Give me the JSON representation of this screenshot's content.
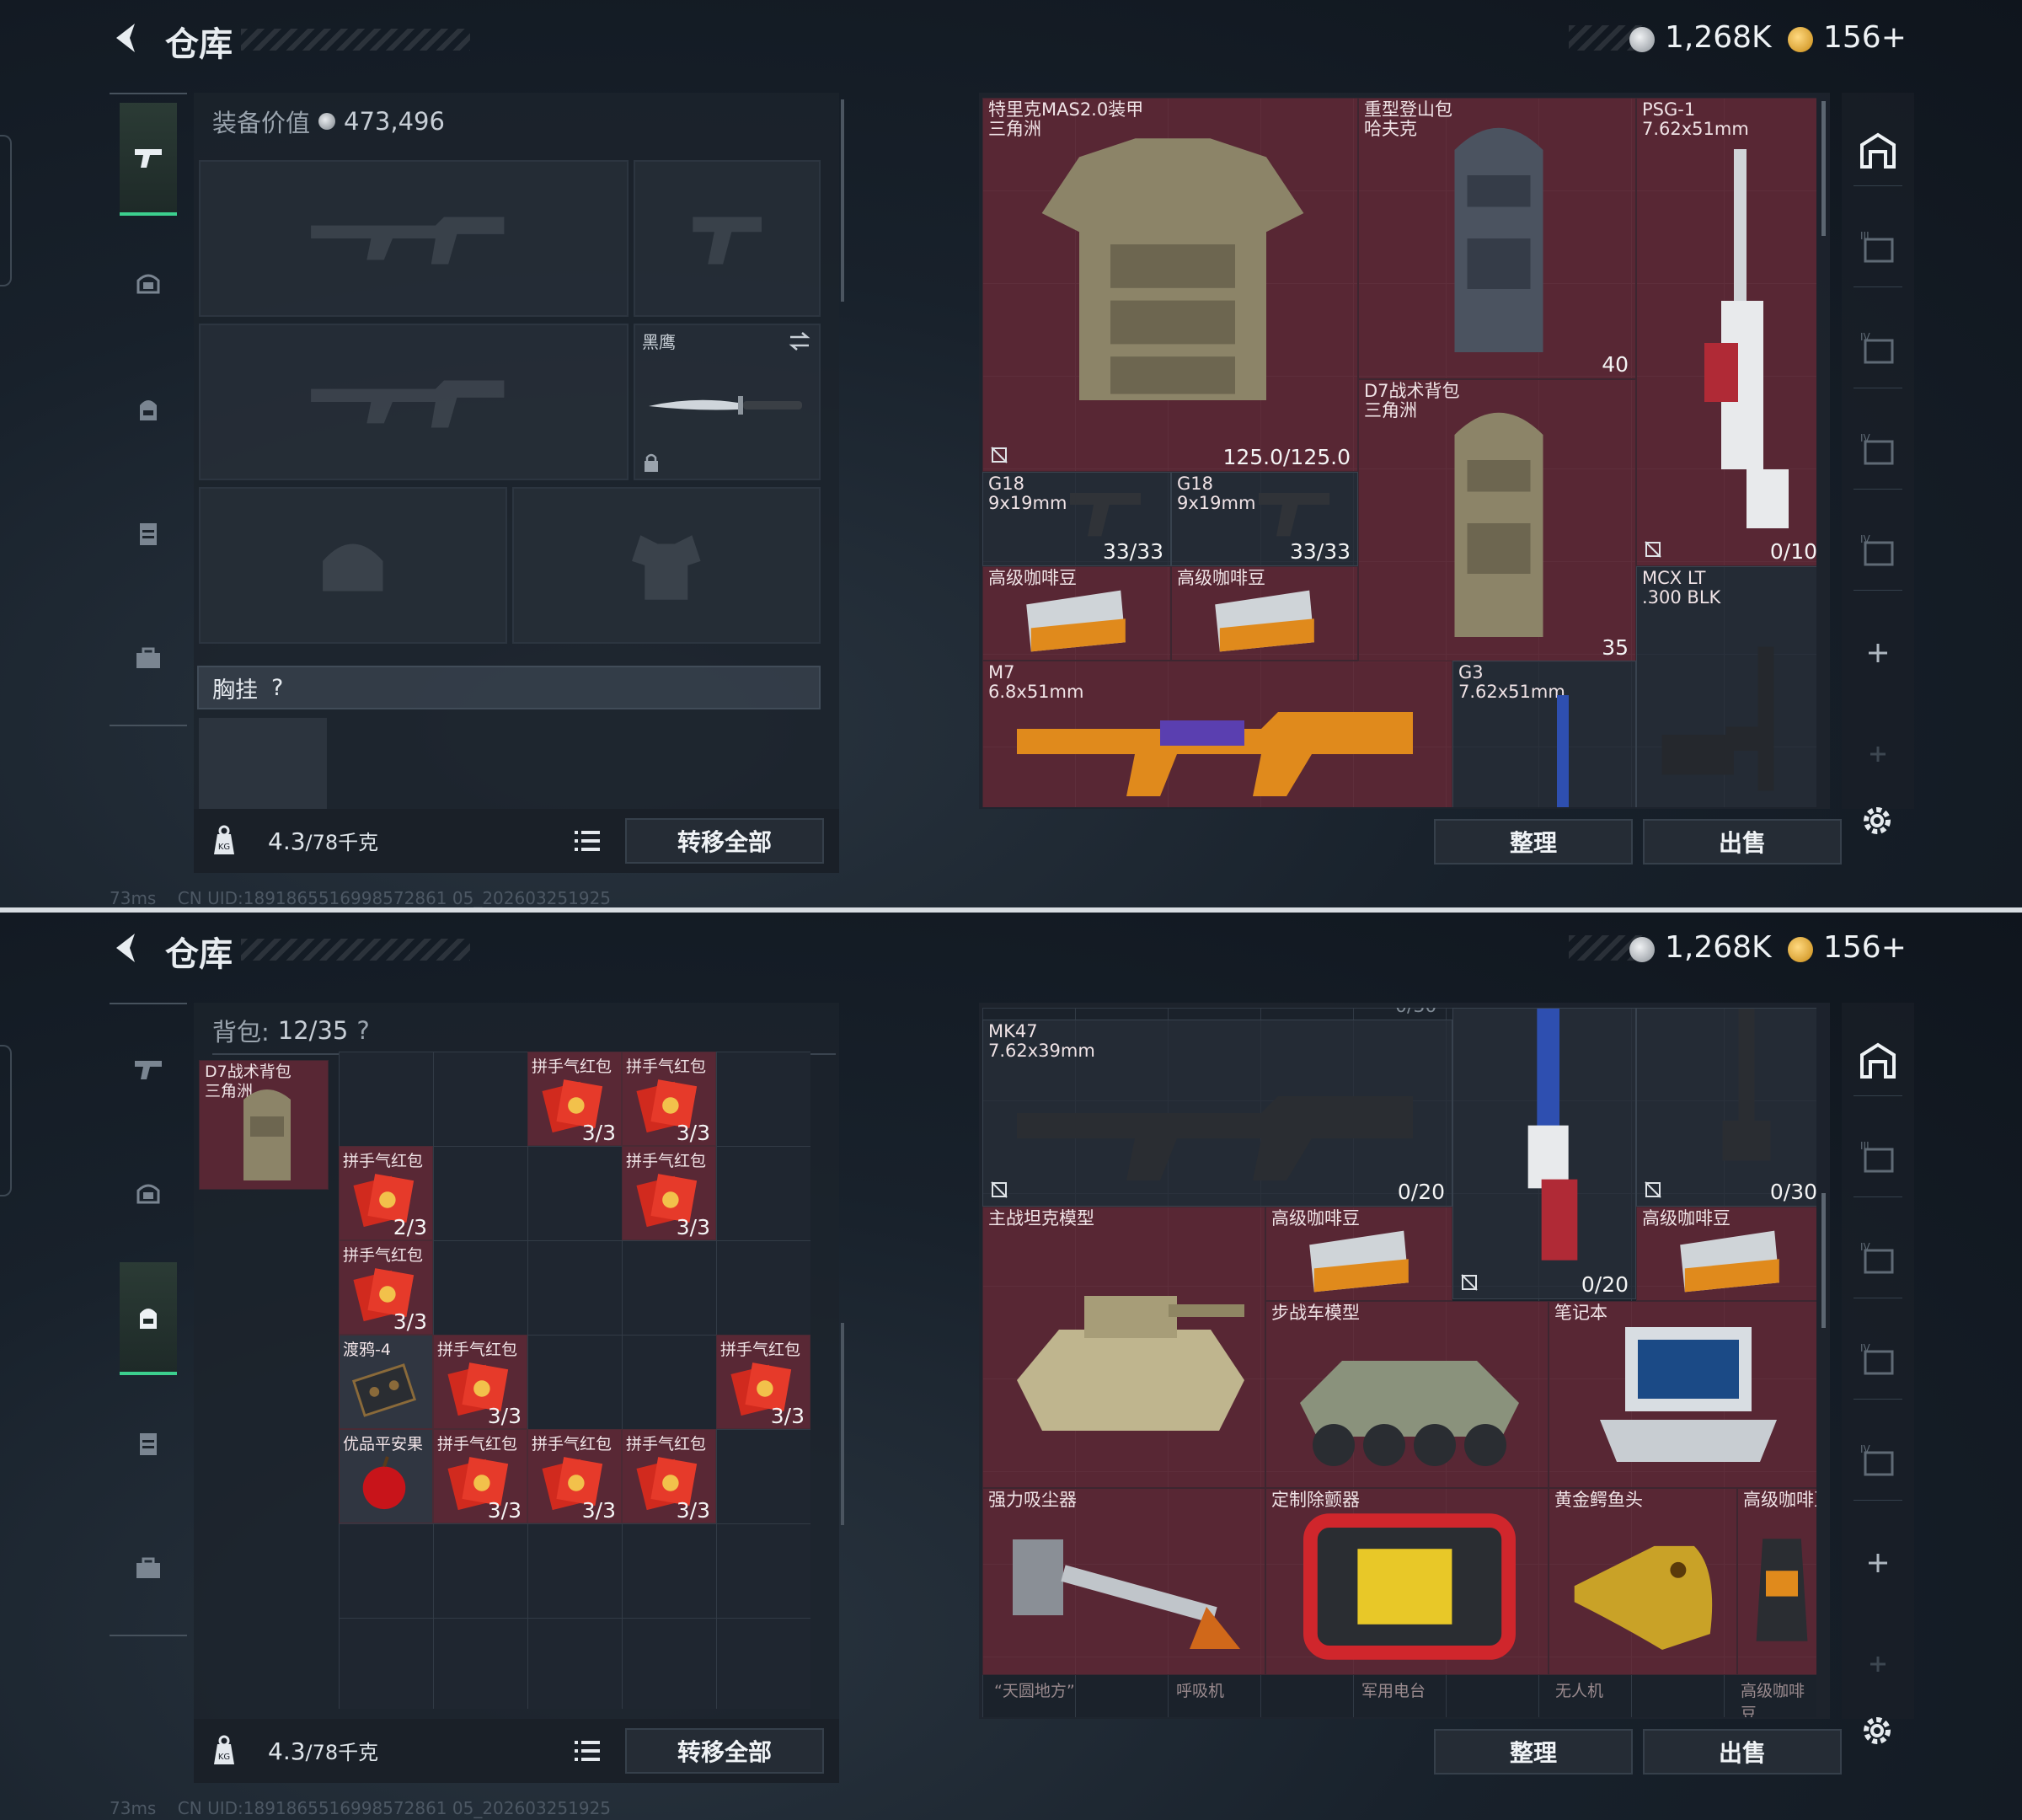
{
  "header": {
    "title": "仓库",
    "currency_silver": "1,268K",
    "currency_gold": "156+"
  },
  "colors": {
    "accent_green": "#3ccf8e",
    "item_red": "#702a37",
    "panel": "#1c232c"
  },
  "footer": {
    "weight": "4.3",
    "weight_max": "/78千克",
    "transfer_all": "转移全部",
    "sort": "整理",
    "sell": "出售"
  },
  "status": {
    "ping": "73ms",
    "uid": "CN UID:1891865516998572861 05_202603251925"
  },
  "screen1": {
    "equip_value_label": "装备价值",
    "equip_value": "473,496",
    "melee_label": "黑鹰",
    "chest_label": "胸挂",
    "chest_help": "?",
    "stash_items": [
      {
        "name": "特里克MAS2.0装甲\n三角洲",
        "count": "125.0/125.0"
      },
      {
        "name": "重型登山包\n哈夫克",
        "count": "40"
      },
      {
        "name": "PSG-1\n7.62x51mm",
        "count": "0/10"
      },
      {
        "name": "D7战术背包\n三角洲",
        "count": "35"
      },
      {
        "name": "G18\n9x19mm",
        "count": "33/33"
      },
      {
        "name": "G18\n9x19mm",
        "count": "33/33"
      },
      {
        "name": "高级咖啡豆",
        "count": ""
      },
      {
        "name": "高级咖啡豆",
        "count": ""
      },
      {
        "name": "MCX LT\n.300 BLK",
        "count": ""
      },
      {
        "name": "M7\n6.8x51mm",
        "count": ""
      },
      {
        "name": "G3\n7.62x51mm",
        "count": ""
      }
    ]
  },
  "screen2": {
    "bag_label": "背包:",
    "bag_count": "12/35",
    "bag_help": "?",
    "bag_item_name": "D7战术背包\n三角洲",
    "bag_items": [
      {
        "name": "拼手气红包",
        "count": "3/3"
      },
      {
        "name": "拼手气红包",
        "count": "3/3"
      },
      {
        "name": "拼手气红包",
        "count": "2/3"
      },
      {
        "name": "拼手气红包",
        "count": "3/3"
      },
      {
        "name": "拼手气红包",
        "count": "3/3"
      },
      {
        "name": "渡鸦-4",
        "count": ""
      },
      {
        "name": "拼手气红包",
        "count": "3/3"
      },
      {
        "name": "拼手气红包",
        "count": "3/3"
      },
      {
        "name": "优品平安果",
        "count": ""
      },
      {
        "name": "拼手气红包",
        "count": "3/3"
      },
      {
        "name": "拼手气红包",
        "count": "3/3"
      },
      {
        "name": "拼手气红包",
        "count": "3/3"
      }
    ],
    "stash_items": [
      {
        "name": "MK47\n7.62x39mm",
        "count": "0/20"
      },
      {
        "name": "",
        "count": "0/30"
      },
      {
        "name": "",
        "count": "0/20"
      },
      {
        "name": "主战坦克模型",
        "count": ""
      },
      {
        "name": "高级咖啡豆",
        "count": ""
      },
      {
        "name": "高级咖啡豆",
        "count": ""
      },
      {
        "name": "步战车模型",
        "count": ""
      },
      {
        "name": "笔记本",
        "count": ""
      },
      {
        "name": "强力吸尘器",
        "count": ""
      },
      {
        "name": "定制除颤器",
        "count": ""
      },
      {
        "name": "黄金鳄鱼头",
        "count": ""
      },
      {
        "name": "高级咖啡豆",
        "count": ""
      }
    ],
    "cut_labels": [
      "“天圆地方”",
      "呼吸机",
      "军用电台",
      "无人机",
      "高级咖啡豆"
    ],
    "top_cut": "0/30"
  }
}
